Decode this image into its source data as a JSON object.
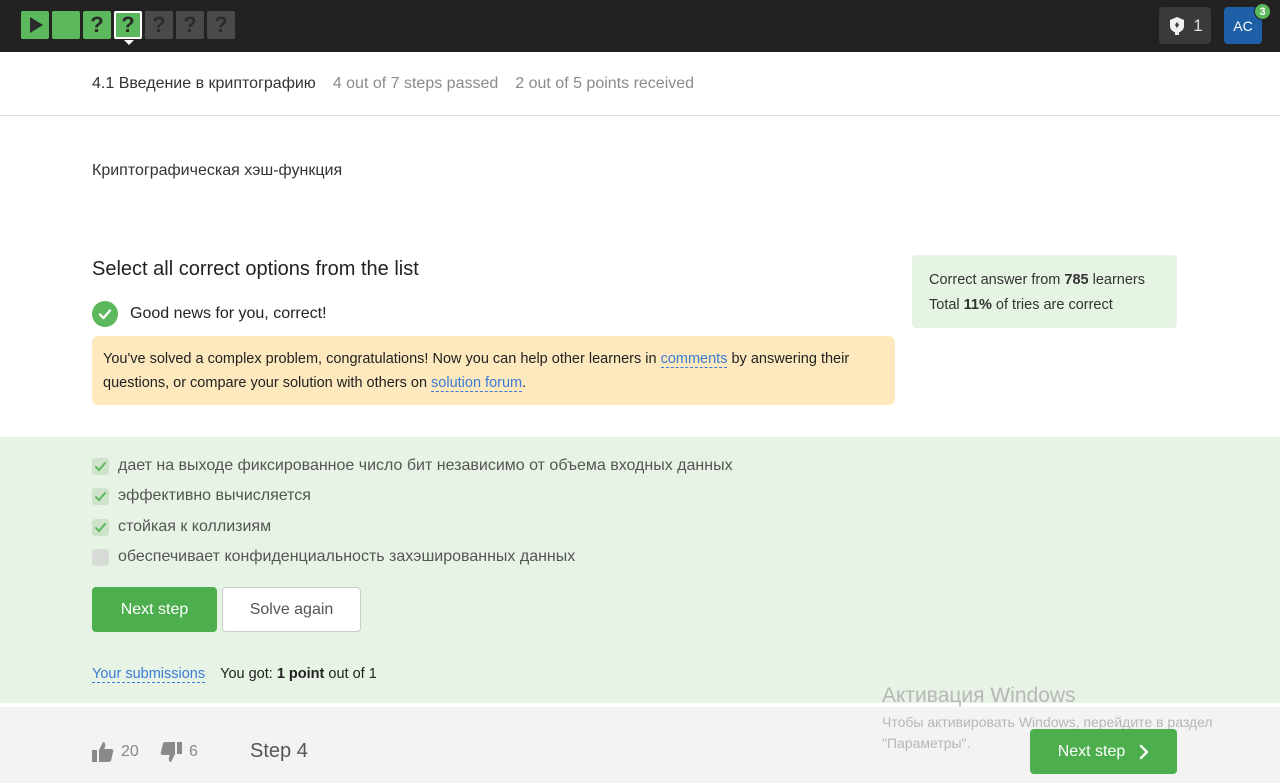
{
  "topbar": {
    "steps": [
      {
        "kind": "play",
        "state": "passed",
        "icon": "play-icon"
      },
      {
        "kind": "blank",
        "state": "passed",
        "label": ""
      },
      {
        "kind": "quiz",
        "state": "passed",
        "label": "?"
      },
      {
        "kind": "quiz",
        "state": "current",
        "label": "?"
      },
      {
        "kind": "quiz",
        "state": "pending",
        "label": "?"
      },
      {
        "kind": "quiz",
        "state": "pending",
        "label": "?"
      },
      {
        "kind": "quiz",
        "state": "pending",
        "label": "?"
      }
    ],
    "notifications_count": "1",
    "notifications_icon": "trophy-icon",
    "avatar_initials": "AC",
    "avatar_badge": "3"
  },
  "lesson": {
    "title": "4.1 Введение в криптографию",
    "steps_passed": "4 out of 7 steps passed",
    "points_received": "2 out of 5 points  received"
  },
  "step": {
    "title": "Криптографическая хэш-функция",
    "quiz_title": "Select all correct options from the list",
    "correct_message": "Good news for you, correct!",
    "congrats_part1": "You've solved a complex problem, congratulations! Now you can help other learners in ",
    "congrats_link1": "comments",
    "congrats_part2": " by answering their questions, or compare your solution with others on ",
    "congrats_link2": "solution forum",
    "congrats_part3": "."
  },
  "stats": {
    "line1_prefix": "Correct answer from ",
    "learners_count": "785",
    "line1_suffix": " learners",
    "line2_prefix": "Total ",
    "percent": "11%",
    "line2_suffix": " of tries are correct"
  },
  "options": [
    {
      "label": "дает на выходе фиксированное число бит независимо от объема входных данных",
      "checked": true
    },
    {
      "label": "эффективно вычисляется",
      "checked": true
    },
    {
      "label": "стойкая к коллизиям",
      "checked": true
    },
    {
      "label": "обеспечивает конфиденциальность захэшированных данных",
      "checked": false
    }
  ],
  "actions": {
    "next_step": "Next step",
    "solve_again": "Solve again",
    "your_submissions": "Your submissions",
    "got_prefix": "You got: ",
    "got_points": "1 point",
    "got_suffix": " out of 1"
  },
  "footer": {
    "likes": "20",
    "dislikes": "6",
    "step_label": "Step 4",
    "next_step": "Next step"
  },
  "watermark": {
    "title": "Активация Windows",
    "subtitle": "Чтобы активировать Windows, перейдите в раздел \"Параметры\"."
  },
  "colors": {
    "accent_green": "#4cae4c",
    "topbar": "#222222",
    "answer_bg": "#e7f4e5",
    "congrats_bg": "#fde9bd",
    "link": "#3a7bd5"
  }
}
